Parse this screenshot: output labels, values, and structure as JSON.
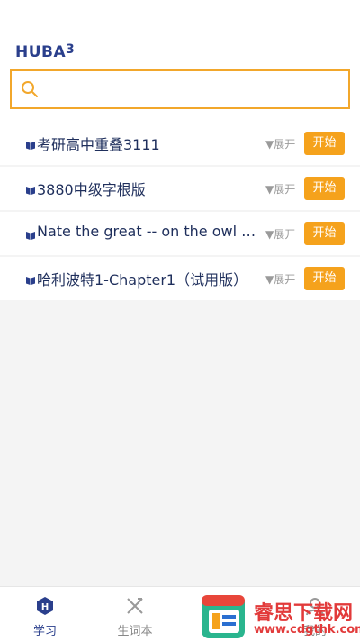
{
  "header": {
    "logo_text": "HUBA",
    "logo_mark": "3"
  },
  "search": {
    "placeholder": ""
  },
  "books": [
    {
      "title": "考研高中重叠3111",
      "expand_label": "▼展开",
      "start_label": "开始"
    },
    {
      "title": "3880中级字根版",
      "expand_label": "▼展开",
      "start_label": "开始"
    },
    {
      "title": "Nate the great -- on the owl e…",
      "expand_label": "▼展开",
      "start_label": "开始"
    },
    {
      "title": "哈利波特1-Chapter1（试用版）",
      "expand_label": "▼展开",
      "start_label": "开始"
    }
  ],
  "tabbar": {
    "tabs": [
      {
        "label": "学习",
        "icon": "study-icon",
        "active": true
      },
      {
        "label": "生词本",
        "icon": "vocab-icon",
        "active": false
      },
      {
        "label": "我的",
        "icon": "profile-icon",
        "active": false
      }
    ]
  },
  "watermark": {
    "name": "睿思下载网",
    "url": "www.cdgthk.com"
  },
  "colors": {
    "accent": "#f5a21c",
    "brand": "#2a3f8c",
    "search_border": "#f2a72b"
  }
}
